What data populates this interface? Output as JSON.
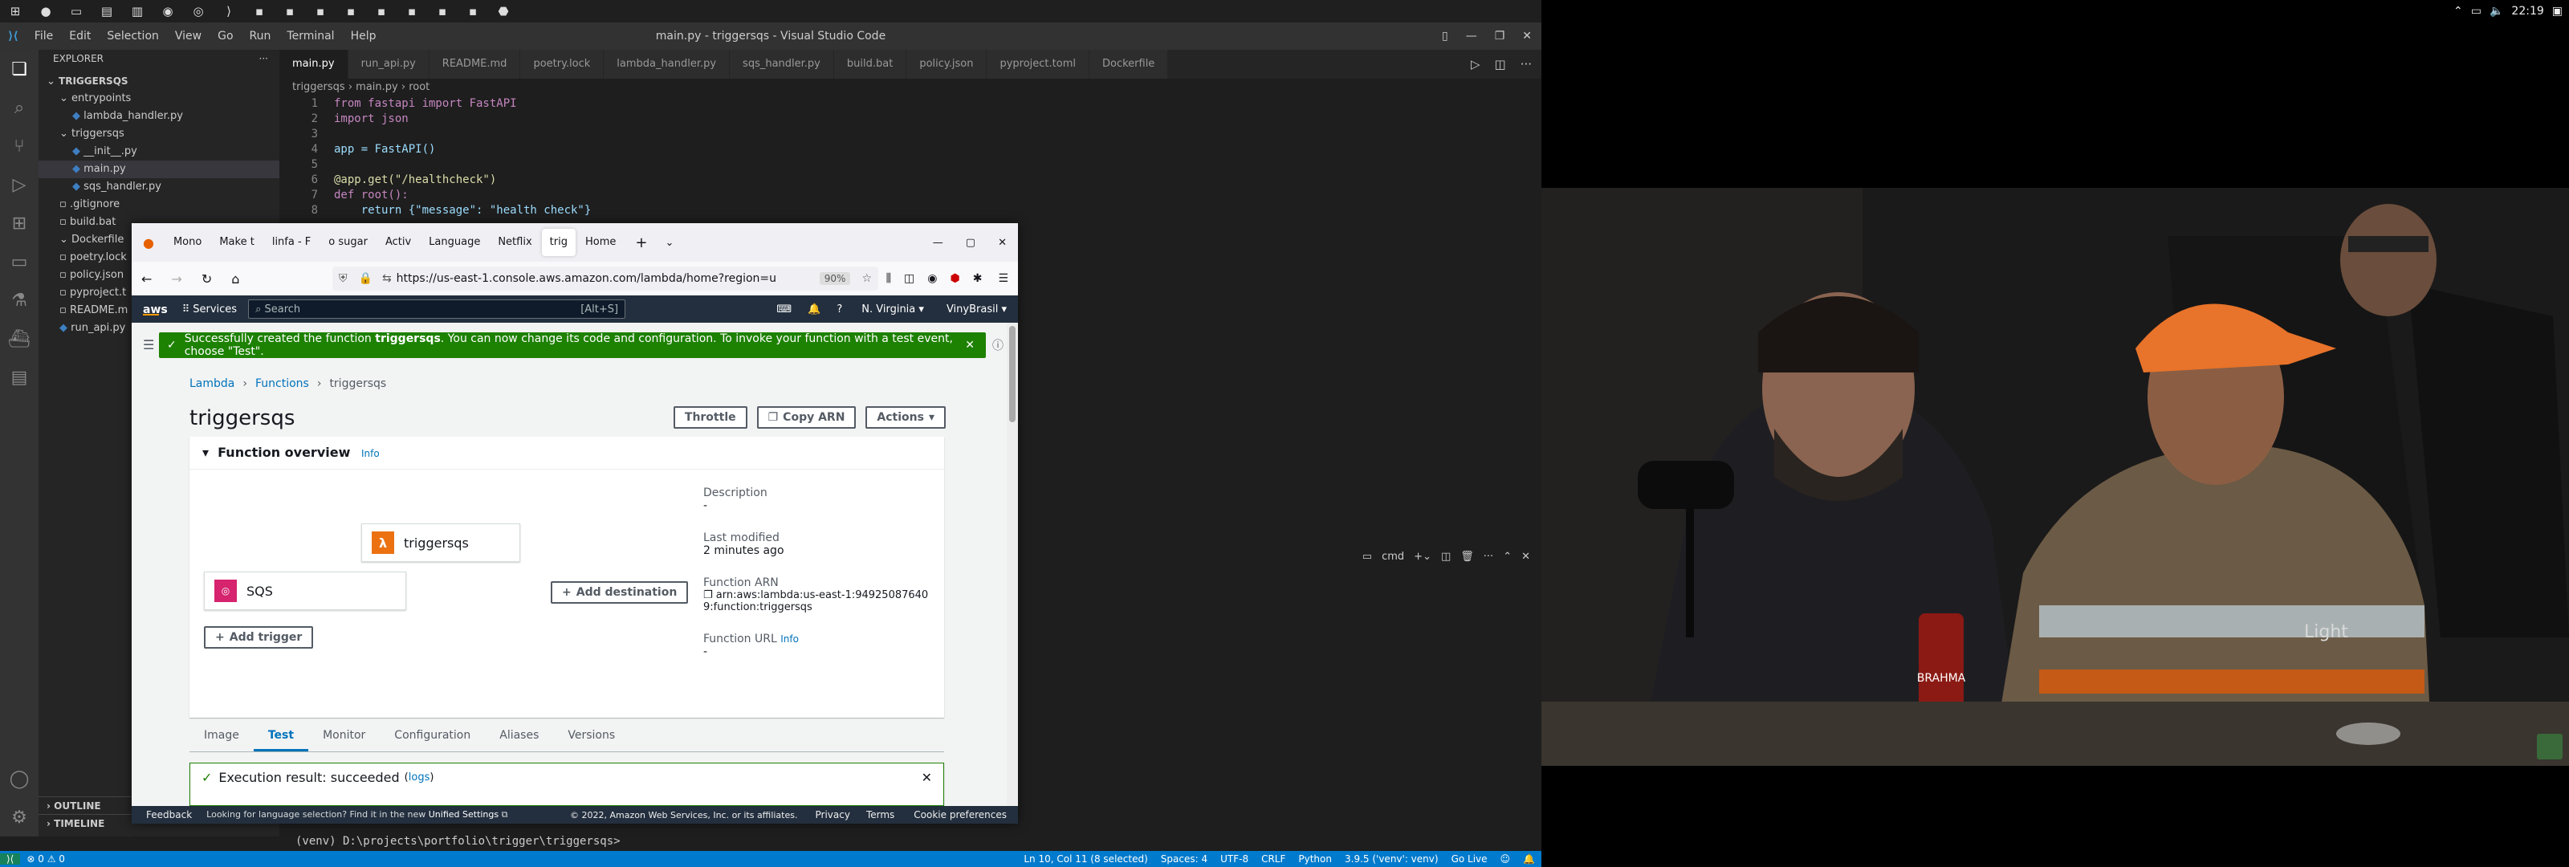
{
  "taskbar": {
    "clock": "22:19",
    "icons": [
      "windows-icon",
      "firefox-icon",
      "terminal-icon",
      "files-icon",
      "explorer-icon",
      "spotify-icon",
      "chrome-icon",
      "vscode-icon",
      "app-icon",
      "app-icon",
      "app-icon",
      "app-icon",
      "app-icon",
      "app-icon",
      "app-icon",
      "app-icon",
      "steam-icon"
    ]
  },
  "vscode": {
    "menu": [
      "File",
      "Edit",
      "Selection",
      "View",
      "Go",
      "Run",
      "Terminal",
      "Help"
    ],
    "title": "main.py - triggersqs - Visual Studio Code",
    "explorer_label": "EXPLORER",
    "tree": [
      {
        "label": "TRIGGERSQS",
        "indent": 0,
        "selected": false
      },
      {
        "label": "entrypoints",
        "indent": 1,
        "selected": false
      },
      {
        "label": "lambda_handler.py",
        "indent": 2,
        "selected": false
      },
      {
        "label": "triggersqs",
        "indent": 1,
        "selected": false
      },
      {
        "label": "__init__.py",
        "indent": 2,
        "selected": false
      },
      {
        "label": "main.py",
        "indent": 2,
        "selected": true
      },
      {
        "label": "sqs_handler.py",
        "indent": 2,
        "selected": false
      },
      {
        "label": ".gitignore",
        "indent": 1,
        "selected": false
      },
      {
        "label": "build.bat",
        "indent": 1,
        "selected": false
      },
      {
        "label": "Dockerfile",
        "indent": 1,
        "selected": false
      },
      {
        "label": "poetry.lock",
        "indent": 1,
        "selected": false
      },
      {
        "label": "policy.json",
        "indent": 1,
        "selected": false
      },
      {
        "label": "pyproject.t",
        "indent": 1,
        "selected": false
      },
      {
        "label": "README.m",
        "indent": 1,
        "selected": false
      },
      {
        "label": "run_api.py",
        "indent": 1,
        "selected": false
      }
    ],
    "outline_label": "OUTLINE",
    "timeline_label": "TIMELINE",
    "tabs": [
      "main.py",
      "run_api.py",
      "README.md",
      "poetry.lock",
      "lambda_handler.py",
      "sqs_handler.py",
      "build.bat",
      "policy.json",
      "pyproject.toml",
      "Dockerfile"
    ],
    "breadcrumb": [
      "triggersqs",
      "main.py",
      "root"
    ],
    "code": [
      "from fastapi import FastAPI",
      "import json",
      "",
      "app = FastAPI()",
      "",
      "@app.get(\"/healthcheck\")",
      "def root():",
      "    return {\"message\": \"health check\"}"
    ],
    "line_numbers": [
      "1",
      "2",
      "3",
      "4",
      "5",
      "6",
      "7",
      "8"
    ],
    "terminal_name": "cmd",
    "terminal_prompt": "(venv) D:\\projects\\portfolio\\trigger\\triggersqs>",
    "status": {
      "left": "⊗ 0 ⚠ 0",
      "position": "Ln 10, Col 11 (8 selected)",
      "spaces": "Spaces: 4",
      "encoding": "UTF-8",
      "eol": "CRLF",
      "language": "Python",
      "interpreter": "3.9.5 ('venv': venv)",
      "golive": "Go Live"
    }
  },
  "firefox": {
    "tabs": [
      "Mono",
      "Make t",
      "linfa - F",
      "o sugar",
      "Activ",
      "Language",
      "Netflix",
      "trig",
      "Home"
    ],
    "active_tab": 7,
    "url": "https://us-east-1.console.aws.amazon.com/lambda/home?region=u",
    "zoom": "90%"
  },
  "aws": {
    "services_label": "Services",
    "search_placeholder": "Search",
    "search_shortcut": "[Alt+S]",
    "region": "N. Virginia",
    "account": "VinyBrasil",
    "flash_prefix": "Successfully created the function ",
    "flash_function": "triggersqs",
    "flash_suffix": ". You can now change its code and configuration. To invoke your function with a test event, choose \"Test\".",
    "breadcrumb": [
      "Lambda",
      "Functions",
      "triggersqs"
    ],
    "page_title": "triggersqs",
    "buttons": {
      "throttle": "Throttle",
      "copy_arn": "Copy ARN",
      "actions": "Actions"
    },
    "overview_title": "Function overview",
    "info": "Info",
    "function_name": "triggersqs",
    "trigger_name": "SQS",
    "add_trigger": "Add trigger",
    "add_destination": "Add destination",
    "description_label": "Description",
    "description_value": "-",
    "last_modified_label": "Last modified",
    "last_modified_value": "2 minutes ago",
    "arn_label": "Function ARN",
    "arn_value": "arn:aws:lambda:us-east-1:949250876409:function:triggersqs",
    "url_label": "Function URL",
    "url_value": "-",
    "tabs": [
      "Image",
      "Test",
      "Monitor",
      "Configuration",
      "Aliases",
      "Versions"
    ],
    "active_tab": 1,
    "exec_prefix": "Execution result: succeeded",
    "exec_logs": "logs",
    "footer": {
      "feedback": "Feedback",
      "language_note": "Looking for language selection? Find it in the new",
      "unified": "Unified Settings",
      "copyright": "© 2022, Amazon Web Services, Inc. or its affiliates.",
      "privacy": "Privacy",
      "terms": "Terms",
      "cookies": "Cookie preferences"
    }
  },
  "video": {
    "can_text": "BRAHMA",
    "shirt_text": "Light"
  }
}
